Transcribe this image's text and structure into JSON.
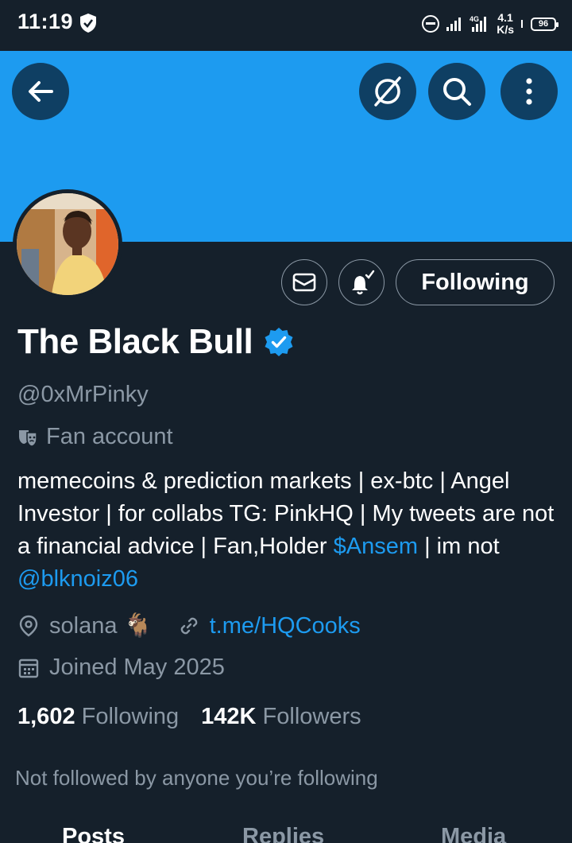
{
  "status_bar": {
    "time": "11:19",
    "network": "4G",
    "speed_value": "4.1",
    "speed_unit": "K/s",
    "battery": "96"
  },
  "colors": {
    "background": "#15202b",
    "banner": "#1d9bf0",
    "accent": "#1d9bf0",
    "muted_text": "#8b98a5",
    "verified_badge": "#1d9bf0"
  },
  "header": {
    "back_icon": "arrow-left-icon",
    "grok_icon": "grok-icon",
    "search_icon": "search-icon",
    "more_icon": "more-vertical-icon"
  },
  "profile": {
    "display_name": "The Black Bull",
    "handle": "@0xMrPinky",
    "account_type": "Fan account",
    "bio_text_1": "memecoins & prediction markets | ex-btc | Angel Investor | for collabs TG: PinkHQ | My tweets are not a financial advice | Fan,Holder ",
    "bio_cashtag": "$Ansem",
    "bio_text_2": " | im not ",
    "bio_mention": "@blknoiz06",
    "location": "solana 🐐",
    "website": "t.me/HQCooks",
    "joined": "Joined May 2025",
    "following_count": "1,602",
    "following_label": "Following",
    "followers_count": "142K",
    "followers_label": "Followers",
    "not_followed_text": "Not followed by anyone you’re following"
  },
  "actions": {
    "message_icon": "mail-icon",
    "notify_icon": "bell-check-icon",
    "follow_button": "Following"
  },
  "tabs": [
    {
      "label": "Posts",
      "active": true
    },
    {
      "label": "Replies",
      "active": false
    },
    {
      "label": "Media",
      "active": false
    }
  ]
}
